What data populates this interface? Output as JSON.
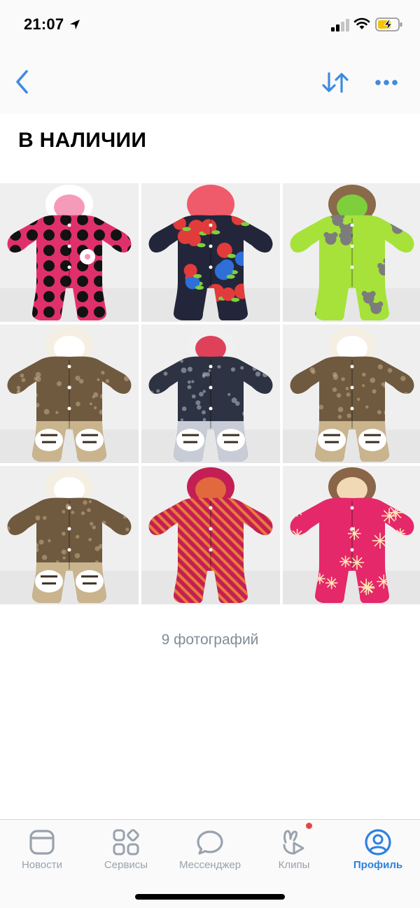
{
  "status_bar": {
    "time": "21:07"
  },
  "header": {
    "title": "В НАЛИЧИИ"
  },
  "photos": [
    {
      "main": "#e0306c",
      "pattern": "#121212",
      "hood": "#ffffff",
      "trim": "#f59ab8",
      "motif": "dots"
    },
    {
      "main": "#23263a",
      "pattern": "#e23b3b",
      "accent": "#2f6fd8",
      "leaf": "#7cd140",
      "hood": "#ef5b6a",
      "trim": "#ef5b6a",
      "motif": "flowers"
    },
    {
      "main": "#a6e23a",
      "pattern": "#7c7c7c",
      "hood": "#8a6a4a",
      "trim": "#7dcf3c",
      "motif": "koala"
    },
    {
      "main": "#6f5a40",
      "pattern": "#c9b48e",
      "hood": "#f4efe2",
      "trim": "#ffffff",
      "motif": "tiger"
    },
    {
      "main": "#2d3342",
      "pattern": "#c7ccd6",
      "hood": "#f0f0f0",
      "trim": "#e0415a",
      "motif": "tiger"
    },
    {
      "main": "#6f5a40",
      "pattern": "#c9b48e",
      "hood": "#f4efe2",
      "trim": "#ffffff",
      "motif": "tiger"
    },
    {
      "main": "#6f5a40",
      "pattern": "#c9b48e",
      "hood": "#f4efe2",
      "trim": "#ffffff",
      "motif": "tiger"
    },
    {
      "main": "#c41f55",
      "pattern": "#e87a3a",
      "hood": "#c41f55",
      "trim": "#e2683e",
      "motif": "stripes"
    },
    {
      "main": "#e5286a",
      "pattern": "#ffe7b5",
      "hood": "#8a6548",
      "trim": "#f2d9b5",
      "motif": "snowflakes"
    }
  ],
  "album": {
    "photo_count_label": "9 фотографий"
  },
  "tabbar": {
    "tabs": [
      {
        "label": "Новости"
      },
      {
        "label": "Сервисы"
      },
      {
        "label": "Мессенджер"
      },
      {
        "label": "Клипы"
      },
      {
        "label": "Профиль"
      }
    ],
    "active_color": "#2d81e0",
    "inactive_color": "#99a2ad"
  },
  "colors": {
    "accent": "#3f8ae0",
    "badge": "#e64646",
    "battery": "#f5c400"
  }
}
